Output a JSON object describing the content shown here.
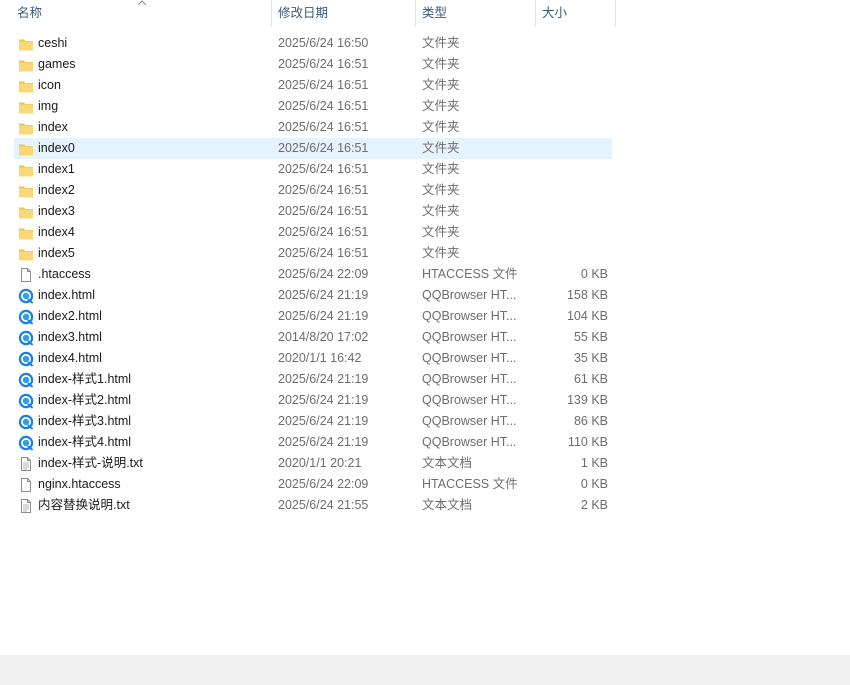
{
  "columns": {
    "name": "名称",
    "date": "修改日期",
    "type": "类型",
    "size": "大小"
  },
  "colors": {
    "selected_row": "#e5f3ff",
    "folder": "#f9d878",
    "header_text": "#3a5a7a"
  },
  "files": [
    {
      "name": "ceshi",
      "date": "2025/6/24 16:50",
      "type": "文件夹",
      "size": "",
      "icon": "folder-icon"
    },
    {
      "name": "games",
      "date": "2025/6/24 16:51",
      "type": "文件夹",
      "size": "",
      "icon": "folder-icon"
    },
    {
      "name": "icon",
      "date": "2025/6/24 16:51",
      "type": "文件夹",
      "size": "",
      "icon": "folder-icon"
    },
    {
      "name": "img",
      "date": "2025/6/24 16:51",
      "type": "文件夹",
      "size": "",
      "icon": "folder-icon"
    },
    {
      "name": "index",
      "date": "2025/6/24 16:51",
      "type": "文件夹",
      "size": "",
      "icon": "folder-icon"
    },
    {
      "name": "index0",
      "date": "2025/6/24 16:51",
      "type": "文件夹",
      "size": "",
      "icon": "folder-icon",
      "selected": true
    },
    {
      "name": "index1",
      "date": "2025/6/24 16:51",
      "type": "文件夹",
      "size": "",
      "icon": "folder-icon"
    },
    {
      "name": "index2",
      "date": "2025/6/24 16:51",
      "type": "文件夹",
      "size": "",
      "icon": "folder-icon"
    },
    {
      "name": "index3",
      "date": "2025/6/24 16:51",
      "type": "文件夹",
      "size": "",
      "icon": "folder-icon"
    },
    {
      "name": "index4",
      "date": "2025/6/24 16:51",
      "type": "文件夹",
      "size": "",
      "icon": "folder-icon"
    },
    {
      "name": "index5",
      "date": "2025/6/24 16:51",
      "type": "文件夹",
      "size": "",
      "icon": "folder-icon"
    },
    {
      "name": ".htaccess",
      "date": "2025/6/24 22:09",
      "type": "HTACCESS 文件",
      "size": "0 KB",
      "icon": "blank-file-icon"
    },
    {
      "name": "index.html",
      "date": "2025/6/24 21:19",
      "type": "QQBrowser HT...",
      "size": "158 KB",
      "icon": "qqbrowser-html-icon"
    },
    {
      "name": "index2.html",
      "date": "2025/6/24 21:19",
      "type": "QQBrowser HT...",
      "size": "104 KB",
      "icon": "qqbrowser-html-icon"
    },
    {
      "name": "index3.html",
      "date": "2014/8/20 17:02",
      "type": "QQBrowser HT...",
      "size": "55 KB",
      "icon": "qqbrowser-html-icon"
    },
    {
      "name": "index4.html",
      "date": "2020/1/1 16:42",
      "type": "QQBrowser HT...",
      "size": "35 KB",
      "icon": "qqbrowser-html-icon"
    },
    {
      "name": "index-样式1.html",
      "date": "2025/6/24 21:19",
      "type": "QQBrowser HT...",
      "size": "61 KB",
      "icon": "qqbrowser-html-icon"
    },
    {
      "name": "index-样式2.html",
      "date": "2025/6/24 21:19",
      "type": "QQBrowser HT...",
      "size": "139 KB",
      "icon": "qqbrowser-html-icon"
    },
    {
      "name": "index-样式3.html",
      "date": "2025/6/24 21:19",
      "type": "QQBrowser HT...",
      "size": "86 KB",
      "icon": "qqbrowser-html-icon"
    },
    {
      "name": "index-样式4.html",
      "date": "2025/6/24 21:19",
      "type": "QQBrowser HT...",
      "size": "110 KB",
      "icon": "qqbrowser-html-icon"
    },
    {
      "name": "index-样式-说明.txt",
      "date": "2020/1/1 20:21",
      "type": "文本文档",
      "size": "1 KB",
      "icon": "text-file-icon"
    },
    {
      "name": "nginx.htaccess",
      "date": "2025/6/24 22:09",
      "type": "HTACCESS 文件",
      "size": "0 KB",
      "icon": "blank-file-icon"
    },
    {
      "name": "内容替换说明.txt",
      "date": "2025/6/24 21:55",
      "type": "文本文档",
      "size": "2 KB",
      "icon": "text-file-icon"
    }
  ]
}
